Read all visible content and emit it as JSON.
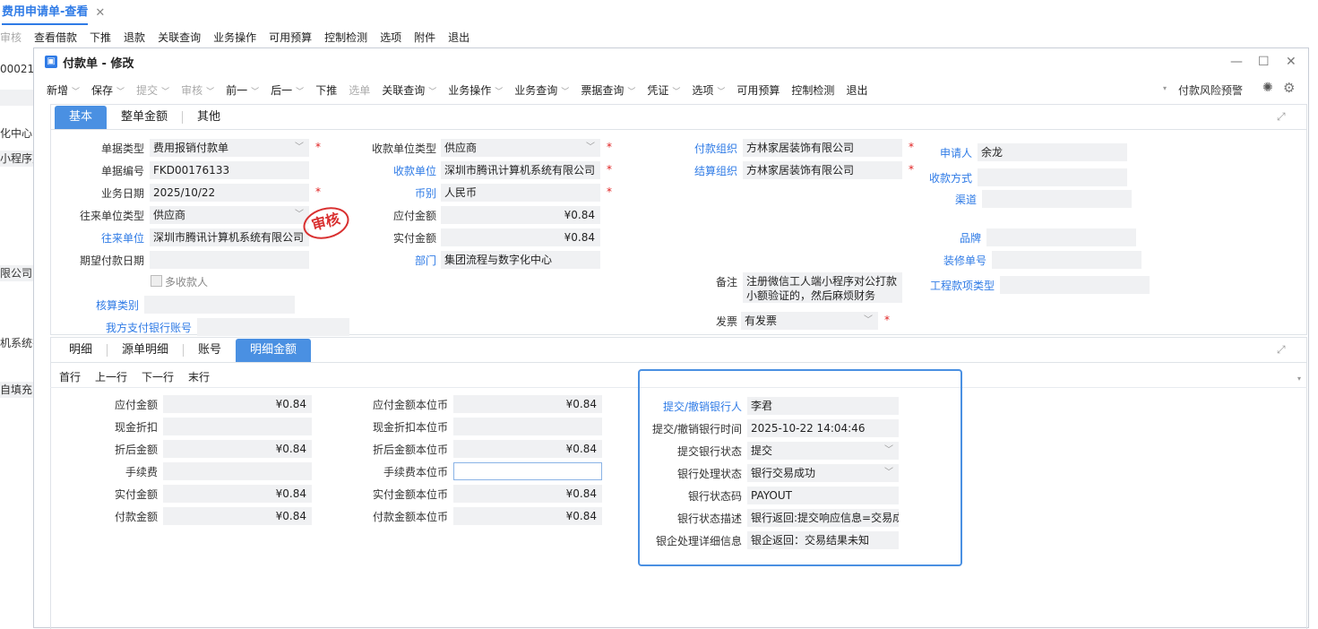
{
  "top_tab": {
    "title": "费用申请单-查看",
    "close": "✕"
  },
  "bg_toolbar": [
    {
      "label": "审核",
      "dis": true
    },
    {
      "label": "查看借款"
    },
    {
      "label": "下推"
    },
    {
      "label": "退款"
    },
    {
      "label": "关联查询"
    },
    {
      "label": "业务操作"
    },
    {
      "label": "可用预算"
    },
    {
      "label": "控制检测"
    },
    {
      "label": "选项"
    },
    {
      "label": "附件"
    },
    {
      "label": "退出"
    }
  ],
  "left_col": [
    "00021",
    "",
    "化中心",
    "小程序对",
    "",
    "限公司",
    "机系统有",
    "自填充"
  ],
  "window": {
    "title": "付款单 - 修改",
    "min": "—",
    "max": "☐",
    "close": "✕"
  },
  "toolbar": [
    "新增",
    "保存",
    "提交",
    "审核",
    "前一",
    "后一",
    "下推",
    "选单",
    "关联查询",
    "业务操作",
    "业务查询",
    "票据查询",
    "凭证",
    "选项",
    "可用预算",
    "控制检测",
    "退出"
  ],
  "toolbar_right": {
    "risk": "付款风险预警"
  },
  "top_tabs": [
    "基本",
    "整单金额",
    "其他"
  ],
  "basic": {
    "bill_type": {
      "label": "单据类型",
      "value": "费用报销付款单"
    },
    "bill_no": {
      "label": "单据编号",
      "value": "FKD00176133"
    },
    "biz_date": {
      "label": "业务日期",
      "value": "2025/10/22"
    },
    "contact_type": {
      "label": "往来单位类型",
      "value": "供应商"
    },
    "contact_unit": {
      "label": "往来单位",
      "value": "深圳市腾讯计算机系统有限公司"
    },
    "expect_date": {
      "label": "期望付款日期",
      "value": ""
    },
    "multi_payee": {
      "label": "多收款人"
    },
    "acct_cat": {
      "label": "核算类别",
      "value": ""
    },
    "our_bank": {
      "label": "我方支付银行账号",
      "value": ""
    },
    "payee_type": {
      "label": "收款单位类型",
      "value": "供应商"
    },
    "payee": {
      "label": "收款单位",
      "value": "深圳市腾讯计算机系统有限公司"
    },
    "currency": {
      "label": "币别",
      "value": "人民币"
    },
    "payable": {
      "label": "应付金额",
      "value": "¥0.84"
    },
    "actual": {
      "label": "实付金额",
      "value": "¥0.84"
    },
    "dept": {
      "label": "部门",
      "value": "集团流程与数字化中心"
    },
    "pay_org": {
      "label": "付款组织",
      "value": "方林家居装饰有限公司"
    },
    "settle_org": {
      "label": "结算组织",
      "value": "方林家居装饰有限公司"
    },
    "remark": {
      "label": "备注",
      "value": "注册微信工人端小程序对公打款小额验证的，然后麻烦财务"
    },
    "invoice": {
      "label": "发票",
      "value": "有发票"
    },
    "applicant": {
      "label": "申请人",
      "value": "余龙"
    },
    "recv_method": {
      "label": "收款方式",
      "value": ""
    },
    "channel": {
      "label": "渠道",
      "value": ""
    },
    "brand": {
      "label": "品牌",
      "value": ""
    },
    "deco_no": {
      "label": "装修单号",
      "value": ""
    },
    "proj_type": {
      "label": "工程款项类型",
      "value": ""
    },
    "seal": "审核"
  },
  "detail_tabs": [
    "明细",
    "源单明细",
    "账号",
    "明细金额"
  ],
  "nav": [
    "首行",
    "上一行",
    "下一行",
    "末行"
  ],
  "amounts": [
    {
      "l": "应付金额",
      "v": "¥0.84",
      "l2": "应付金额本位币",
      "v2": "¥0.84"
    },
    {
      "l": "现金折扣",
      "v": "",
      "l2": "现金折扣本位币",
      "v2": ""
    },
    {
      "l": "折后金额",
      "v": "¥0.84",
      "l2": "折后金额本位币",
      "v2": "¥0.84"
    },
    {
      "l": "手续费",
      "v": "",
      "l2": "手续费本位币",
      "v2": ""
    },
    {
      "l": "实付金额",
      "v": "¥0.84",
      "l2": "实付金额本位币",
      "v2": "¥0.84"
    },
    {
      "l": "付款金额",
      "v": "¥0.84",
      "l2": "付款金额本位币",
      "v2": "¥0.84"
    }
  ],
  "bank": [
    {
      "l": "提交/撤销银行人",
      "v": "李君",
      "blue": true
    },
    {
      "l": "提交/撤销银行时间",
      "v": "2025-10-22 14:04:46"
    },
    {
      "l": "提交银行状态",
      "v": "提交",
      "sel": true
    },
    {
      "l": "银行处理状态",
      "v": "银行交易成功",
      "sel": true
    },
    {
      "l": "银行状态码",
      "v": "PAYOUT"
    },
    {
      "l": "银行状态描述",
      "v": "银行返回:提交响应信息=交易成"
    },
    {
      "l": "银企处理详细信息",
      "v": "银企返回：交易结果未知"
    }
  ]
}
